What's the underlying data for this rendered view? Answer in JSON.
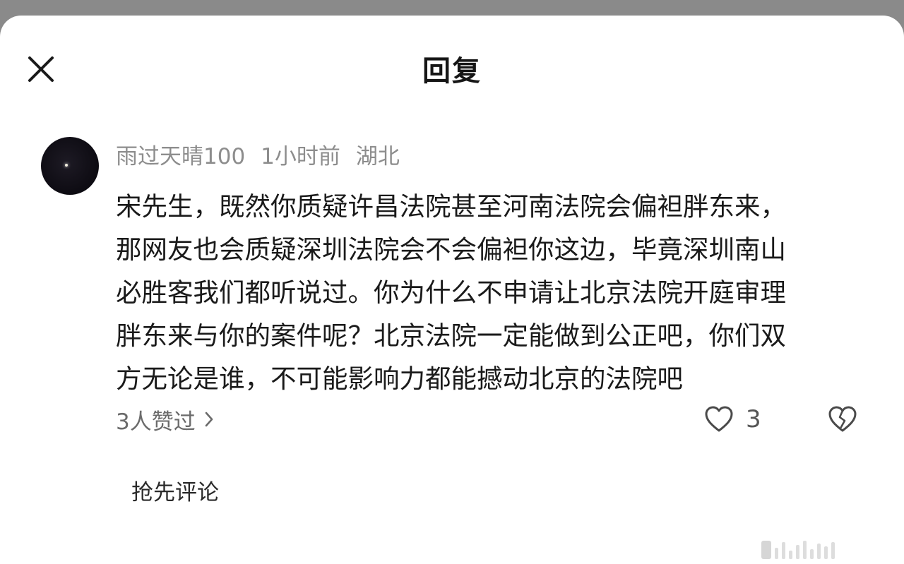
{
  "header": {
    "title": "回复",
    "close_icon": "close-icon"
  },
  "comment": {
    "avatar": "avatar-night-sky",
    "username": "雨过天晴100",
    "time": "1小时前",
    "location": "湖北",
    "lines": [
      "宋先生，既然你质疑许昌法院甚至河南法院会偏袒胖东来，",
      "那网友也会质疑深圳法院会不会偏袒你这边，毕竟深圳南山",
      "必胜客我们都听说过。你为什么不申请让北京法院开庭审理",
      "胖东来与你的案件呢？北京法院一定能做到公正吧，你们双",
      "方无论是谁，不可能影响力都能撼动北京的法院吧"
    ],
    "liked_by": "3人赞过",
    "like_count": "3",
    "heart_icon": "heart-outline-icon",
    "dislike_icon": "broken-heart-icon"
  },
  "actions": {
    "first_comment": "抢先评论"
  },
  "colors": {
    "background": "#ffffff",
    "overlay": "#8a8a8a",
    "meta_text": "#8d8d8d",
    "body_text": "#1a1a1a"
  }
}
